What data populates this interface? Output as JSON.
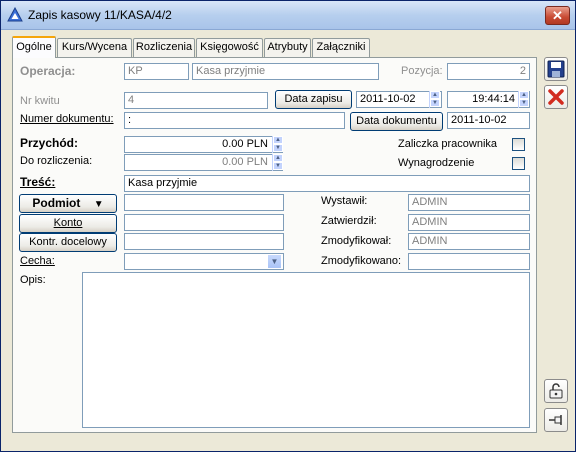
{
  "window": {
    "title": "Zapis kasowy 11/KASA/4/2",
    "close_glyph": "✕"
  },
  "tabs": [
    {
      "label": "Ogólne"
    },
    {
      "label": "Kurs/Wycena"
    },
    {
      "label": "Rozliczenia"
    },
    {
      "label": "Księgowość"
    },
    {
      "label": "Atrybuty"
    },
    {
      "label": "Załączniki"
    }
  ],
  "form": {
    "operacja_label": "Operacja:",
    "operacja_code": "KP",
    "operacja_name": "Kasa przyjmie",
    "pozycja_label": "Pozycja:",
    "pozycja_value": "2",
    "nr_kwitu_label": "Nr kwitu",
    "nr_kwitu_value": "4",
    "data_zapisu_button": "Data zapisu",
    "data_zapisu_value": "2011-10-02",
    "time_value": "19:44:14",
    "nr_dokumentu_label": "Numer dokumentu:",
    "nr_dokumentu_value": ":",
    "data_dokumentu_button": "Data dokumentu",
    "data_dokumentu_value": "2011-10-02",
    "przychod_label": "Przychód:",
    "przychod_value": "0.00 PLN",
    "do_rozliczenia_label": "Do rozliczenia:",
    "do_rozliczenia_value": "0.00 PLN",
    "zaliczka_label": "Zaliczka pracownika",
    "wynagrodzenie_label": "Wynagrodzenie",
    "tresc_label": "Treść:",
    "tresc_value": "Kasa przyjmie",
    "podmiot_button": "Podmiot",
    "konto_button": "Konto",
    "kontr_button": "Kontr. docelowy",
    "cecha_label": "Cecha:",
    "opis_label": "Opis:",
    "wystawil_label": "Wystawił:",
    "wystawil_value": "ADMIN",
    "zatwierdzil_label": "Zatwierdził:",
    "zatwierdzil_value": "ADMIN",
    "zmodyfikowal_label": "Zmodyfikował:",
    "zmodyfikowal_value": "ADMIN",
    "zmodyfikowano_label": "Zmodyfikowano:",
    "zmodyfikowano_value": ""
  },
  "icons": {
    "save": "save-icon",
    "cancel": "cancel-icon",
    "lock": "lock-icon",
    "pin": "pin-icon"
  },
  "colors": {
    "cancel_red": "#d22b1f",
    "accent_tab": "#f5a50a"
  }
}
